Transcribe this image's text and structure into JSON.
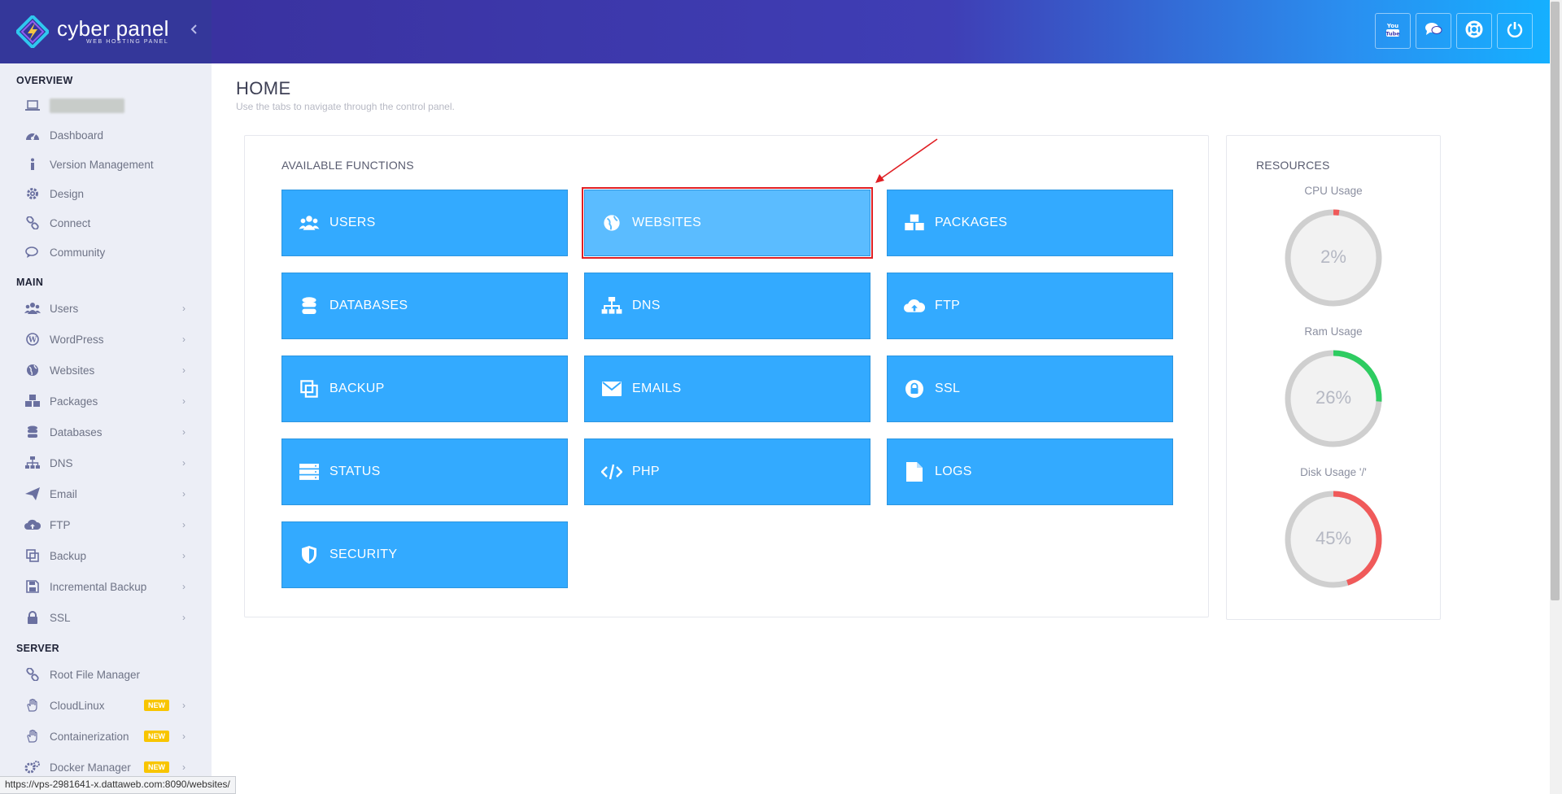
{
  "brand": {
    "name": "cyber panel",
    "tagline": "WEB HOSTING PANEL"
  },
  "sidebar": {
    "sections": [
      {
        "title": "OVERVIEW",
        "items": [
          {
            "label": "",
            "icon": "laptop-icon",
            "redacted": true
          },
          {
            "label": "Dashboard",
            "icon": "dashboard-gauge-icon"
          },
          {
            "label": "Version Management",
            "icon": "info-icon"
          },
          {
            "label": "Design",
            "icon": "gear-icon"
          },
          {
            "label": "Connect",
            "icon": "link-icon"
          },
          {
            "label": "Community",
            "icon": "chat-icon"
          }
        ]
      },
      {
        "title": "MAIN",
        "items": [
          {
            "label": "Users",
            "icon": "users-icon",
            "chevron": true
          },
          {
            "label": "WordPress",
            "icon": "wordpress-icon",
            "chevron": true
          },
          {
            "label": "Websites",
            "icon": "globe-icon",
            "chevron": true
          },
          {
            "label": "Packages",
            "icon": "cubes-icon",
            "chevron": true
          },
          {
            "label": "Databases",
            "icon": "database-icon",
            "chevron": true
          },
          {
            "label": "DNS",
            "icon": "sitemap-icon",
            "chevron": true
          },
          {
            "label": "Email",
            "icon": "paper-plane-icon",
            "chevron": true
          },
          {
            "label": "FTP",
            "icon": "cloud-upload-icon",
            "chevron": true
          },
          {
            "label": "Backup",
            "icon": "copy-icon",
            "chevron": true
          },
          {
            "label": "Incremental Backup",
            "icon": "floppy-icon",
            "chevron": true
          },
          {
            "label": "SSL",
            "icon": "lock-icon",
            "chevron": true
          }
        ]
      },
      {
        "title": "SERVER",
        "items": [
          {
            "label": "Root File Manager",
            "icon": "link-icon"
          },
          {
            "label": "CloudLinux",
            "icon": "hand-icon",
            "chevron": true,
            "badge": "NEW"
          },
          {
            "label": "Containerization",
            "icon": "hand-icon",
            "chevron": true,
            "badge": "NEW"
          },
          {
            "label": "Docker Manager",
            "icon": "cogs-icon",
            "chevron": true,
            "badge": "NEW"
          }
        ]
      }
    ]
  },
  "header": {
    "buttons": [
      {
        "name": "youtube-button",
        "icon": "youtube-icon"
      },
      {
        "name": "chat-button",
        "icon": "comments-icon"
      },
      {
        "name": "support-button",
        "icon": "lifebuoy-icon"
      },
      {
        "name": "logout-button",
        "icon": "power-icon"
      }
    ]
  },
  "page": {
    "title": "HOME",
    "subtitle": "Use the tabs to navigate through the control panel."
  },
  "functions": {
    "title": "AVAILABLE FUNCTIONS",
    "items": [
      {
        "label": "USERS",
        "icon": "users-icon"
      },
      {
        "label": "WEBSITES",
        "icon": "globe-icon",
        "highlighted": true
      },
      {
        "label": "PACKAGES",
        "icon": "cubes-icon"
      },
      {
        "label": "DATABASES",
        "icon": "database-icon"
      },
      {
        "label": "DNS",
        "icon": "sitemap-icon"
      },
      {
        "label": "FTP",
        "icon": "cloud-upload-icon"
      },
      {
        "label": "BACKUP",
        "icon": "copy-icon"
      },
      {
        "label": "EMAILS",
        "icon": "envelope-icon"
      },
      {
        "label": "SSL",
        "icon": "lock-icon"
      },
      {
        "label": "STATUS",
        "icon": "server-icon"
      },
      {
        "label": "PHP",
        "icon": "code-icon"
      },
      {
        "label": "LOGS",
        "icon": "file-icon"
      },
      {
        "label": "SECURITY",
        "icon": "shield-icon"
      }
    ]
  },
  "resources": {
    "title": "RESOURCES",
    "gauges": [
      {
        "label": "CPU Usage",
        "value": "2%",
        "percent": 2,
        "color": "#f05a5a"
      },
      {
        "label": "Ram Usage",
        "value": "26%",
        "percent": 26,
        "color": "#2ecc61"
      },
      {
        "label": "Disk Usage '/'",
        "value": "45%",
        "percent": 45,
        "color": "#f05a5a"
      }
    ]
  },
  "statusbar": {
    "url": "https://vps-2981641-x.dattaweb.com:8090/websites/"
  },
  "colors": {
    "accent": "#33aaff",
    "sidebar_bg": "#eceef6",
    "header_start": "#3a32a0",
    "header_end": "#15b0ff",
    "highlight": "#e01f24"
  }
}
